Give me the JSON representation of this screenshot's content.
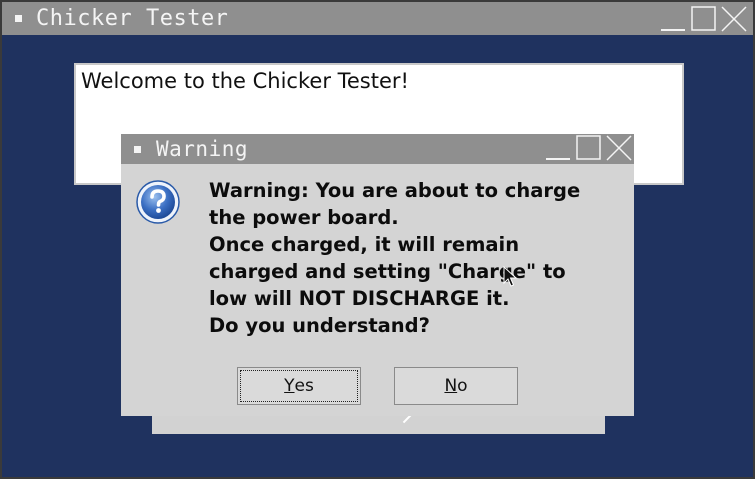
{
  "main_window": {
    "title": "Chicker Tester",
    "welcome_text": "Welcome to the Chicker Tester!"
  },
  "dialog": {
    "title": "Warning",
    "icon": "question-icon",
    "message": "Warning: You are about to charge\nthe power board.\nOnce charged, it will remain\ncharged and setting \"Charge\" to\nlow will NOT DISCHARGE it.\nDo you understand?",
    "buttons": {
      "yes": {
        "mnemonic": "Y",
        "rest": "es"
      },
      "no": {
        "mnemonic": "N",
        "rest": "o"
      }
    }
  },
  "colors": {
    "desktop": "#1f325f",
    "titlebar": "#8f8f8f",
    "dialog_bg": "#d4d4d4"
  }
}
